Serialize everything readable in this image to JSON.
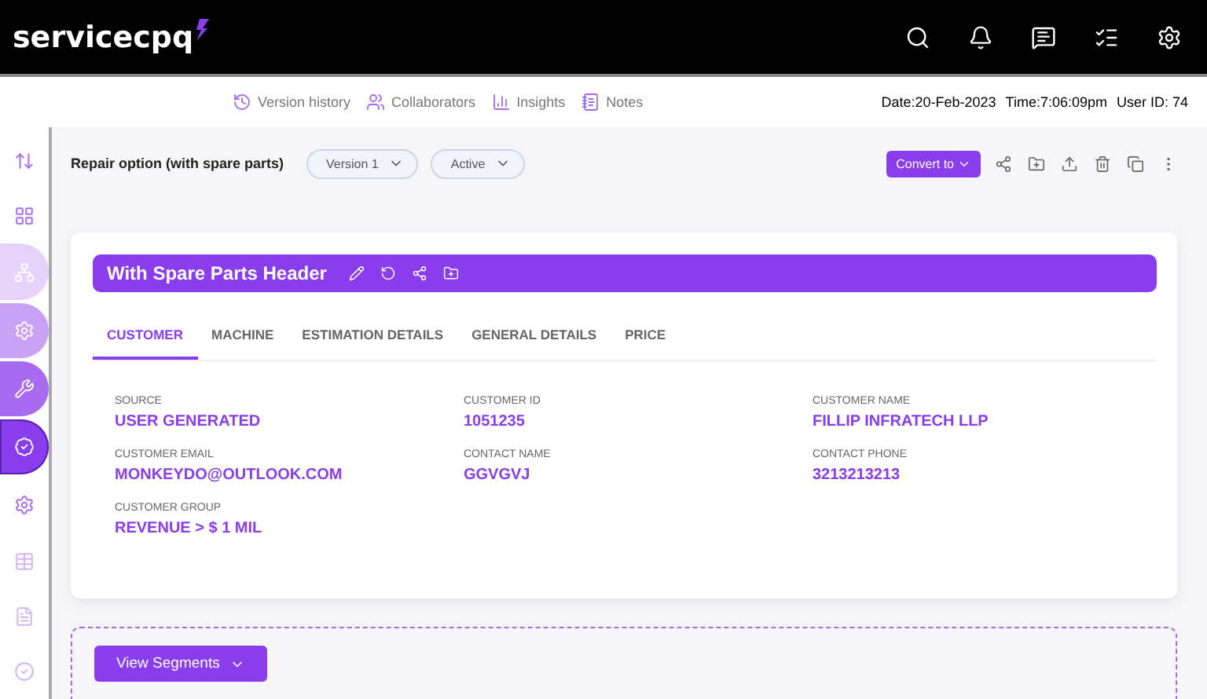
{
  "header": {
    "logo": "servicecpq",
    "icons": [
      {
        "kind": "search"
      },
      {
        "kind": "bell"
      },
      {
        "kind": "chat"
      },
      {
        "kind": "list"
      },
      {
        "kind": "settings"
      }
    ]
  },
  "subbar": {
    "links": [
      {
        "kind": "history",
        "label": "Version history"
      },
      {
        "kind": "people",
        "label": "Collaborators"
      },
      {
        "kind": "chart",
        "label": "Insights"
      },
      {
        "kind": "notes",
        "label": "Notes"
      }
    ],
    "date": "Date:20-Feb-2023",
    "time": "Time:7:06:09pm",
    "user": "User ID: 74"
  },
  "sidebar": {
    "items": [
      {
        "kind": "swap",
        "selected": false
      },
      {
        "kind": "grid",
        "selected": false
      },
      {
        "kind": "tree",
        "selected": false,
        "color": "#e6d3fb"
      },
      {
        "kind": "gear",
        "selected": false,
        "color": "#c9a2f5"
      },
      {
        "kind": "wrench",
        "selected": false,
        "color": "#a86af0"
      },
      {
        "kind": "badge",
        "selected": true,
        "color": "#8a3ded"
      },
      {
        "kind": "gear",
        "selected": false
      },
      {
        "kind": "table",
        "selected": false
      },
      {
        "kind": "doc",
        "selected": false
      },
      {
        "kind": "check",
        "selected": false
      }
    ]
  },
  "toolbar": {
    "title": "Repair option (with spare parts)",
    "dropdowns": [
      "Version 1",
      "Active"
    ],
    "convert": "Convert to",
    "actions": [
      {
        "kind": "share"
      },
      {
        "kind": "folder"
      },
      {
        "kind": "upload"
      },
      {
        "kind": "trash"
      },
      {
        "kind": "copy"
      },
      {
        "kind": "more"
      }
    ]
  },
  "card": {
    "title": "With Spare Parts Header",
    "header_icons": [
      {
        "kind": "pencil"
      },
      {
        "kind": "undo"
      },
      {
        "kind": "share"
      },
      {
        "kind": "folder"
      }
    ],
    "tabs": [
      {
        "label": "CUSTOMER",
        "selected": true
      },
      {
        "label": "MACHINE",
        "selected": false
      },
      {
        "label": "ESTIMATION DETAILS",
        "selected": false
      },
      {
        "label": "GENERAL DETAILS",
        "selected": false
      },
      {
        "label": "PRICE",
        "selected": false
      }
    ],
    "fields": [
      {
        "label": "SOURCE",
        "value": "USER GENERATED"
      },
      {
        "label": "CUSTOMER ID",
        "value": "1051235"
      },
      {
        "label": "CUSTOMER NAME",
        "value": "FILLIP INFRATECH LLP"
      },
      {
        "label": "CUSTOMER EMAIL",
        "value": "MONKEYDO@OUTLOOK.COM"
      },
      {
        "label": "CONTACT NAME",
        "value": "GGVGVJ"
      },
      {
        "label": "CONTACT PHONE",
        "value": "3213213213"
      },
      {
        "label": "CUSTOMER GROUP",
        "value": "REVENUE > $ 1 MIL"
      }
    ]
  },
  "segments": {
    "button": "View Segments"
  }
}
